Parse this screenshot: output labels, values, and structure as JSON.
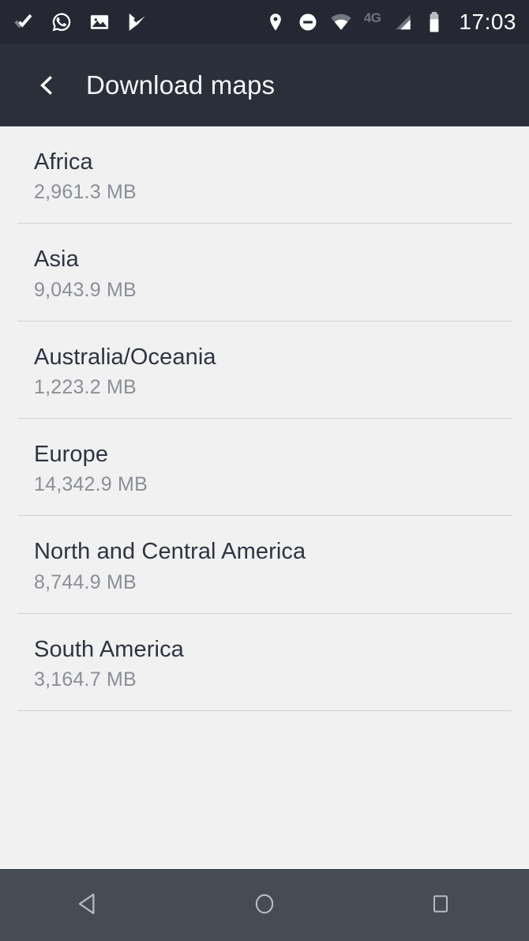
{
  "status_bar": {
    "left_icons": [
      {
        "name": "checkmark-icon",
        "label": "check"
      },
      {
        "name": "whatsapp-icon",
        "label": "WhatsApp"
      },
      {
        "name": "gallery-image-icon",
        "label": "Gallery"
      },
      {
        "name": "flag-check-icon",
        "label": "Tasks"
      }
    ],
    "right_icons": [
      {
        "name": "location-pin-icon",
        "label": "Location"
      },
      {
        "name": "do-not-disturb-icon",
        "label": "Do not disturb"
      },
      {
        "name": "wifi-icon",
        "label": "Wi-Fi"
      }
    ],
    "network_type": "4G",
    "signal_icon": "cellular-signal-icon",
    "battery_icon": "battery-icon",
    "time": "17:03",
    "background_color": "#252833",
    "icon_color": "#ffffff",
    "dim_color": "#6f737e"
  },
  "app_bar": {
    "back_icon": "back-chevron-icon",
    "title": "Download maps",
    "background_color": "#2b2f3a",
    "title_color": "#f4f5f7"
  },
  "list": {
    "items": [
      {
        "title": "Africa",
        "size": "2,961.3 MB"
      },
      {
        "title": "Asia",
        "size": "9,043.9 MB"
      },
      {
        "title": "Australia/Oceania",
        "size": "1,223.2 MB"
      },
      {
        "title": "Europe",
        "size": "14,342.9 MB"
      },
      {
        "title": "North and Central America",
        "size": "8,744.9 MB"
      },
      {
        "title": "South America",
        "size": "3,164.7 MB"
      }
    ],
    "background_color": "#f1f1f2",
    "title_color": "#2e3440",
    "size_color": "#8b8f96",
    "divider_color": "#d2d3d5"
  },
  "nav_bar": {
    "buttons": [
      {
        "name": "nav-back-button",
        "icon": "triangle-back-icon"
      },
      {
        "name": "nav-home-button",
        "icon": "circle-home-icon"
      },
      {
        "name": "nav-recents-button",
        "icon": "square-recents-icon"
      }
    ],
    "background_color": "#454c54",
    "icon_color": "#b7bcc0"
  }
}
